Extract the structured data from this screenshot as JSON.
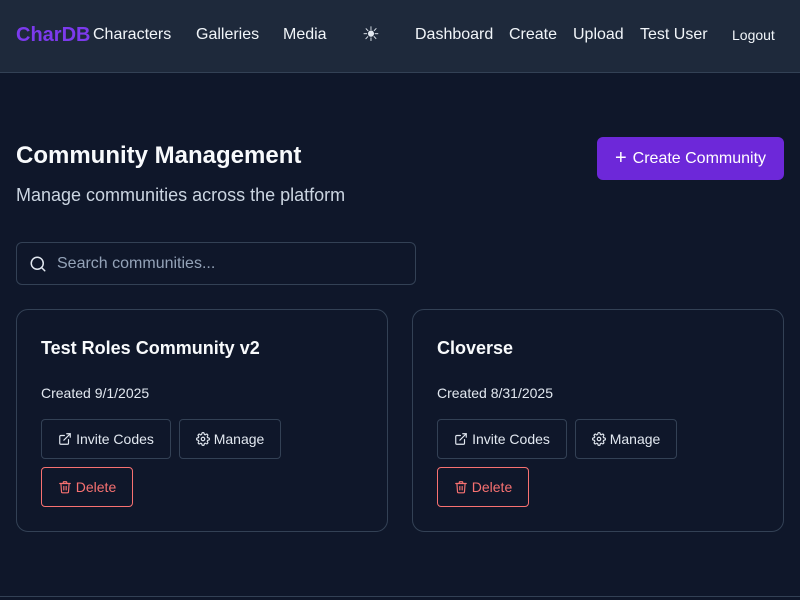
{
  "nav": {
    "brand": "CharDB",
    "links": [
      "Characters",
      "Galleries",
      "Media"
    ],
    "theme_icon": "☀",
    "right_links": [
      "Dashboard",
      "Create",
      "Upload",
      "Test User"
    ],
    "logout": "Logout"
  },
  "header": {
    "title": "Community Management",
    "subtitle": "Manage communities across the platform",
    "create_label": "Create Community"
  },
  "search": {
    "placeholder": "Search communities..."
  },
  "communities": [
    {
      "name": "Test Roles Community v2",
      "created": "Created 9/1/2025",
      "invite_label": "Invite Codes",
      "manage_label": "Manage",
      "delete_label": "Delete"
    },
    {
      "name": "Cloverse",
      "created": "Created 8/31/2025",
      "invite_label": "Invite Codes",
      "manage_label": "Manage",
      "delete_label": "Delete"
    }
  ],
  "colors": {
    "background": "#0f172a",
    "topbar": "#1e293b",
    "brand": "#7c3aed",
    "primary": "#6d28d9",
    "danger": "#f87171",
    "border": "#334155"
  }
}
